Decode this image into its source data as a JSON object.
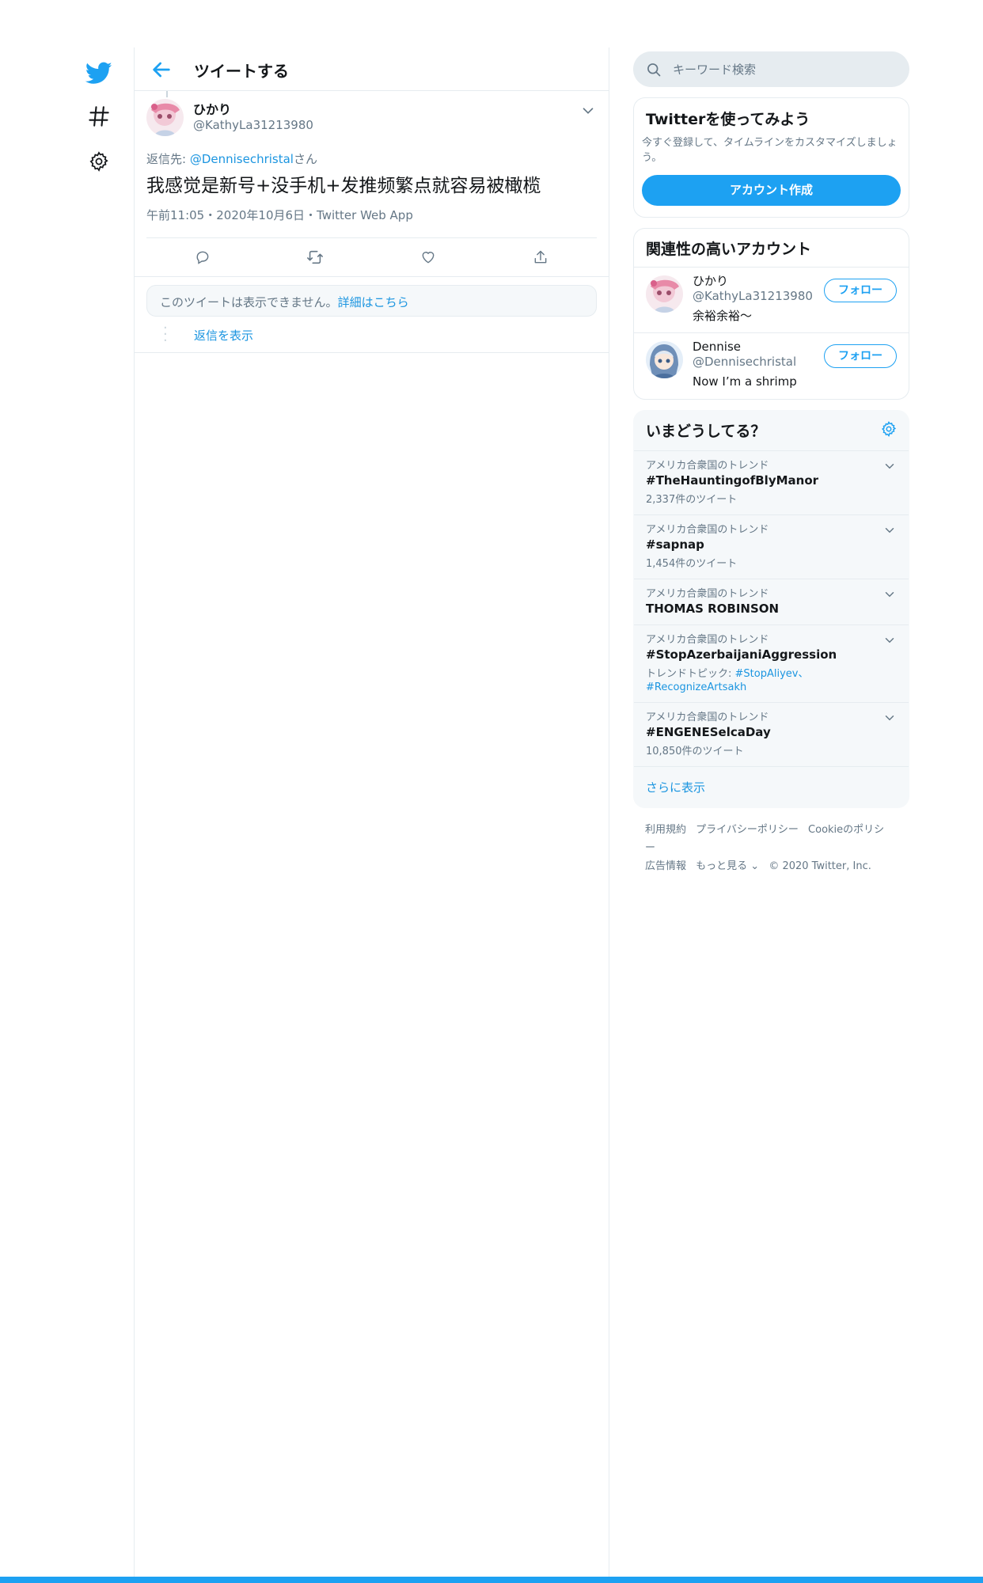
{
  "header": {
    "title": "ツイートする"
  },
  "tweet": {
    "display_name": "ひかり",
    "handle": "@KathyLa31213980",
    "reply_prefix": "返信先: ",
    "reply_target": "@Dennisechristal",
    "reply_suffix": "さん",
    "text": "我感觉是新号+没手机+发推频繁点就容易被橄榄",
    "meta": "午前11:05・2020年10月6日・Twitter Web App"
  },
  "unavailable": {
    "text": "このツイートは表示できません。",
    "link": "詳細はこちら"
  },
  "show_replies": "返信を表示",
  "search": {
    "placeholder": "キーワード検索"
  },
  "signup": {
    "title": "Twitterを使ってみよう",
    "desc": "今すぐ登録して、タイムラインをカスタマイズしましょう。",
    "button": "アカウント作成"
  },
  "related": {
    "title": "関連性の高いアカウント",
    "accounts": [
      {
        "name": "ひかり",
        "handle": "@KathyLa31213980",
        "bio": "余裕余裕～",
        "button": "フォロー"
      },
      {
        "name": "Dennise",
        "handle": "@Dennisechristal",
        "bio": "Now I’m a shrimp",
        "button": "フォロー"
      }
    ]
  },
  "trends": {
    "title": "いまどうしてる？",
    "items": [
      {
        "context": "アメリカ合衆国のトレンド",
        "name": "#TheHauntingofBlyManor",
        "count": "2,337件のツイート"
      },
      {
        "context": "アメリカ合衆国のトレンド",
        "name": "#sapnap",
        "count": "1,454件のツイート"
      },
      {
        "context": "アメリカ合衆国のトレンド",
        "name": "THOMAS ROBINSON",
        "count": ""
      },
      {
        "context": "アメリカ合衆国のトレンド",
        "name": "#StopAzerbaijaniAggression",
        "topic_label": "トレンドトピック: ",
        "topic_links": "#StopAliyev、#RecognizeArtsakh"
      },
      {
        "context": "アメリカ合衆国のトレンド",
        "name": "#ENGENESelcaDay",
        "count": "10,850件のツイート"
      }
    ],
    "show_more": "さらに表示"
  },
  "footer": {
    "links": [
      "利用規約",
      "プライバシーポリシー",
      "Cookieのポリシー",
      "広告情報",
      "もっと見る ⌄"
    ],
    "copyright": "© 2020 Twitter, Inc."
  },
  "colors": {
    "accent": "#1da1f2",
    "link": "#1b95e0",
    "muted": "#657786",
    "border": "#e6ecf0"
  }
}
